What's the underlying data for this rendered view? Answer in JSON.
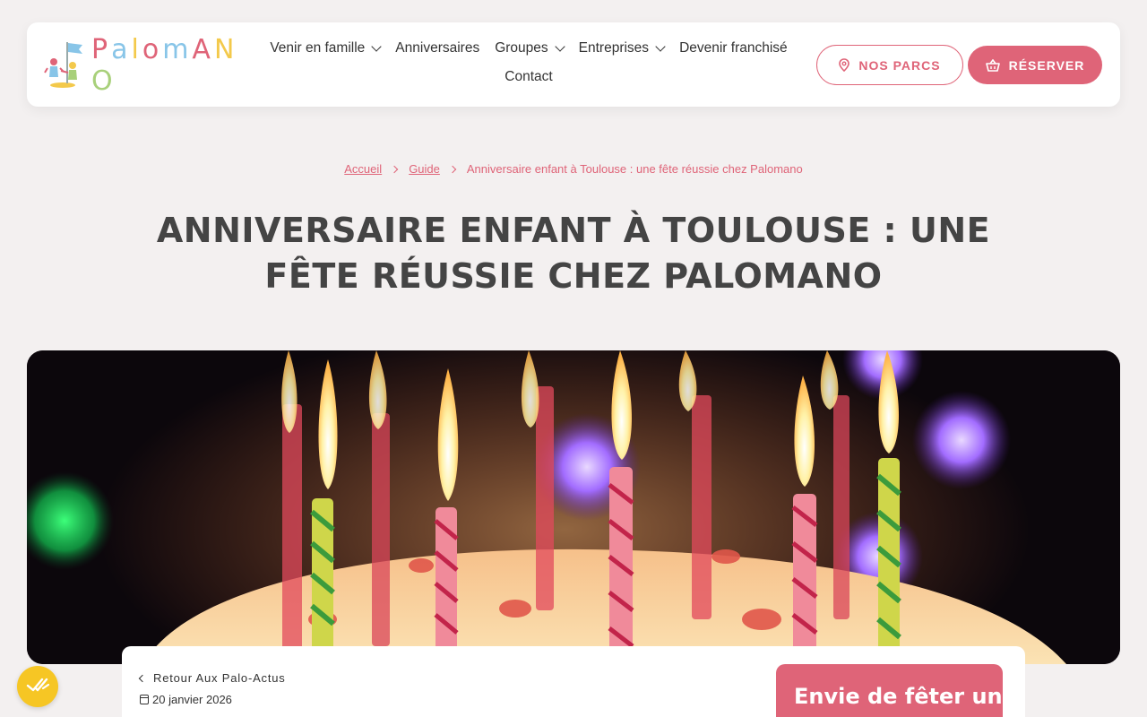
{
  "logo": {
    "text": "PALOMANO",
    "letters": [
      "P",
      "a",
      "l",
      "o",
      "m",
      "A",
      "N",
      "O"
    ],
    "letter_colors": [
      "#df6478",
      "#88c5e8",
      "#f3c94b",
      "#df6478",
      "#88c5e8",
      "#df6478",
      "#f3c94b",
      "#a8d07a"
    ]
  },
  "nav": {
    "items": [
      {
        "label": "Venir en famille",
        "dropdown": true
      },
      {
        "label": "Anniversaires",
        "dropdown": false
      },
      {
        "label": "Groupes",
        "dropdown": true
      },
      {
        "label": "Entreprises",
        "dropdown": true
      },
      {
        "label": "Devenir franchisé",
        "dropdown": false
      },
      {
        "label": "Contact",
        "dropdown": false
      }
    ]
  },
  "header_buttons": {
    "parcs_label": "NOS PARCS",
    "reserver_label": "RÉSERVER"
  },
  "breadcrumb": {
    "home": "Accueil",
    "guide": "Guide",
    "current": "Anniversaire enfant à Toulouse : une fête réussie chez Palomano"
  },
  "page": {
    "title": "ANNIVERSAIRE ENFANT À TOULOUSE : UNE FÊTE RÉUSSIE CHEZ PALOMANO"
  },
  "article": {
    "back_label": "Retour Aux Palo-Actus",
    "date": "20 janvier 2026",
    "cta_title": "Envie de fêter un"
  },
  "colors": {
    "accent": "#df6478",
    "background": "#f3f0f0",
    "badge": "#f6c624"
  },
  "icons": {
    "parcs": "map-pin-icon",
    "reserver": "basket-icon",
    "badge": "checkmark-icon"
  }
}
